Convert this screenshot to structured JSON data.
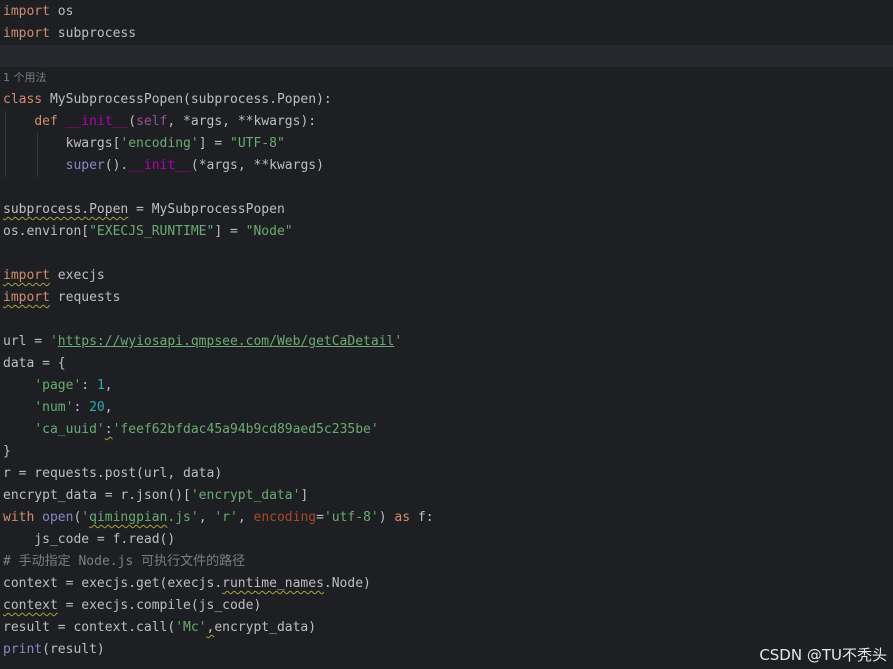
{
  "editor": {
    "lines": [
      [
        {
          "t": "import",
          "c": "kw"
        },
        {
          "t": " os"
        }
      ],
      [
        {
          "t": "import",
          "c": "kw"
        },
        {
          "t": " subprocess"
        }
      ],
      [],
      [
        {
          "t": "1 个用法",
          "c": "hint"
        }
      ],
      [
        {
          "t": "class",
          "c": "kw"
        },
        {
          "t": " MySubprocessPopen(subprocess.Popen):"
        }
      ],
      [
        {
          "t": "    "
        },
        {
          "t": "def",
          "c": "kw"
        },
        {
          "t": " "
        },
        {
          "t": "__init__",
          "c": "dunder"
        },
        {
          "t": "("
        },
        {
          "t": "self",
          "c": "self"
        },
        {
          "t": ", *args, **kwargs):"
        }
      ],
      [
        {
          "t": "        kwargs["
        },
        {
          "t": "'encoding'",
          "c": "str"
        },
        {
          "t": "] = "
        },
        {
          "t": "\"UTF-8\"",
          "c": "str"
        }
      ],
      [
        {
          "t": "        "
        },
        {
          "t": "super",
          "c": "bi"
        },
        {
          "t": "()."
        },
        {
          "t": "__init__",
          "c": "dunder"
        },
        {
          "t": "(*args, **kwargs)"
        }
      ],
      [],
      [
        {
          "t": "subprocess.Popen",
          "c": "wavy"
        },
        {
          "t": " = MySubprocessPopen"
        }
      ],
      [
        {
          "t": "os.environ["
        },
        {
          "t": "\"EXECJS_RUNTIME\"",
          "c": "str"
        },
        {
          "t": "] = "
        },
        {
          "t": "\"Node\"",
          "c": "str"
        }
      ],
      [],
      [
        {
          "t": "import",
          "c": "kw wavy"
        },
        {
          "t": " execjs"
        }
      ],
      [
        {
          "t": "import",
          "c": "kw wavy"
        },
        {
          "t": " requests"
        }
      ],
      [],
      [
        {
          "t": "url = "
        },
        {
          "t": "'",
          "c": "str"
        },
        {
          "t": "https://wyiosapi.qmpsee.com/Web/getCaDetail",
          "c": "str link"
        },
        {
          "t": "'",
          "c": "str"
        }
      ],
      [
        {
          "t": "data = {"
        }
      ],
      [
        {
          "t": "    "
        },
        {
          "t": "'page'",
          "c": "str"
        },
        {
          "t": ": "
        },
        {
          "t": "1",
          "c": "num"
        },
        {
          "t": ","
        }
      ],
      [
        {
          "t": "    "
        },
        {
          "t": "'num'",
          "c": "str"
        },
        {
          "t": ": "
        },
        {
          "t": "20",
          "c": "num"
        },
        {
          "t": ","
        }
      ],
      [
        {
          "t": "    "
        },
        {
          "t": "'ca_uuid'",
          "c": "str"
        },
        {
          "t": ":",
          "c": "wavy"
        },
        {
          "t": "'feef62bfdac45a94b9cd89aed5c235be'",
          "c": "str"
        }
      ],
      [
        {
          "t": "}"
        }
      ],
      [
        {
          "t": "r = requests.post(url, data)"
        }
      ],
      [
        {
          "t": "encrypt_data = r.json()["
        },
        {
          "t": "'encrypt_data'",
          "c": "str"
        },
        {
          "t": "]"
        }
      ],
      [
        {
          "t": "with",
          "c": "kw"
        },
        {
          "t": " "
        },
        {
          "t": "open",
          "c": "bi"
        },
        {
          "t": "("
        },
        {
          "t": "'",
          "c": "str"
        },
        {
          "t": "qimingpian",
          "c": "str wavy"
        },
        {
          "t": ".js'",
          "c": "str"
        },
        {
          "t": ", "
        },
        {
          "t": "'r'",
          "c": "str"
        },
        {
          "t": ", "
        },
        {
          "t": "encoding",
          "c": "param"
        },
        {
          "t": "="
        },
        {
          "t": "'utf-8'",
          "c": "str"
        },
        {
          "t": ") "
        },
        {
          "t": "as",
          "c": "kw"
        },
        {
          "t": " f:"
        }
      ],
      [
        {
          "t": "    js_code = f.read()"
        }
      ],
      [
        {
          "t": "# 手动指定 Node.js 可执行文件的路径",
          "c": "cmt"
        }
      ],
      [
        {
          "t": "context = execjs.get(execjs."
        },
        {
          "t": "runtime_names",
          "c": "wavy"
        },
        {
          "t": ".Node)"
        }
      ],
      [
        {
          "t": "context",
          "c": "wavy"
        },
        {
          "t": " = execjs.compile(js_code)"
        }
      ],
      [
        {
          "t": "result = context.call("
        },
        {
          "t": "'Mc'",
          "c": "str"
        },
        {
          "t": ",",
          "c": "wavy"
        },
        {
          "t": "encrypt_data)"
        }
      ],
      [
        {
          "t": "print",
          "c": "bi"
        },
        {
          "t": "(result)"
        }
      ]
    ]
  },
  "watermark": "CSDN @TU不秃头"
}
